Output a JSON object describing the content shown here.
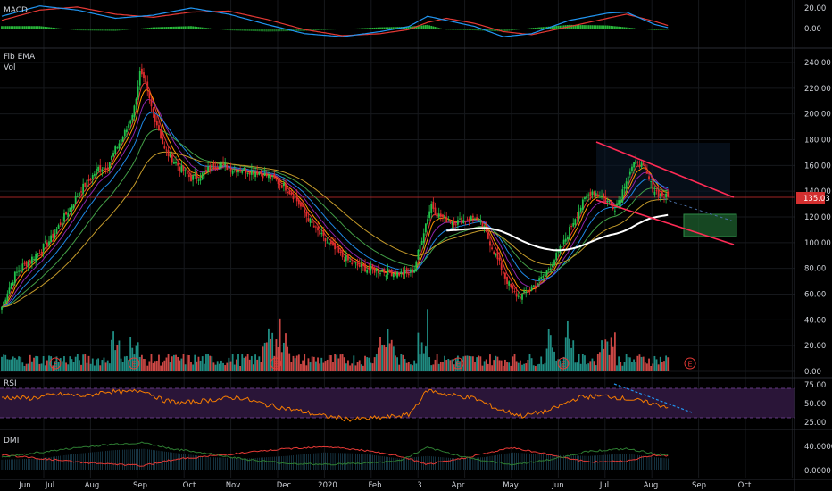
{
  "colors": {
    "background": "#000000",
    "grid": "#16181c",
    "separator": "#2a2d33",
    "text": "#cfd2d8",
    "up": "#26a69a",
    "down": "#ef5350",
    "upBright": "#22c34b",
    "downBright": "#e02d2d",
    "macdLine": "#2196f3",
    "signalLine": "#e53935",
    "histUp": "#2ecc40",
    "rsi": "#f57c00",
    "rsiBand": "#2a1538",
    "rsiBandEdge": "#7b4aa0",
    "pricePanelLine": "#d32f2f",
    "dmiPlus": "#2e7d32",
    "dmiMinus": "#e53935",
    "adx": "#4fc3f7",
    "channel": "#ff2b55",
    "target": "#1e5f2e",
    "ema": [
      "#e53935",
      "#ff9800",
      "#8e24aa",
      "#1e88e5",
      "#43a047",
      "#c49a2a"
    ],
    "longMA": "#ffffff",
    "earnings": "#e53935"
  },
  "panels": {
    "macd": {
      "label": "MACD",
      "ticks": [
        "20.00",
        "0.00"
      ]
    },
    "price": {
      "label1": "Fib EMA",
      "label2": "Vol",
      "ticks": [
        "240.00",
        "220.00",
        "200.00",
        "180.00",
        "160.00",
        "140.00",
        "120.00",
        "100.00",
        "80.00",
        "60.00",
        "40.00",
        "20.00",
        "0.00"
      ],
      "last_price": "135.03"
    },
    "rsi": {
      "label": "RSI",
      "ticks": [
        "75.00",
        "50.00",
        "25.00"
      ]
    },
    "dmi": {
      "label": "DMI",
      "ticks": [
        "40.0000",
        "0.0000"
      ]
    }
  },
  "earnings_label": "E",
  "chart_data": [
    {
      "type": "candlestick",
      "title": "Fib EMA",
      "x_labels": [
        "Jun",
        "Jul",
        "Aug",
        "Sep",
        "Oct",
        "Nov",
        "Dec",
        "2020",
        "Feb",
        "3",
        "Apr",
        "May",
        "Jun",
        "Jul",
        "Aug",
        "Sep",
        "Oct"
      ],
      "ylim": [
        0,
        250
      ],
      "last_price": 135.03,
      "close_path": [
        [
          0,
          50
        ],
        [
          3,
          62
        ],
        [
          7,
          75
        ],
        [
          11,
          82
        ],
        [
          16,
          88
        ],
        [
          21,
          95
        ],
        [
          26,
          103
        ],
        [
          31,
          115
        ],
        [
          36,
          127
        ],
        [
          41,
          140
        ],
        [
          46,
          148
        ],
        [
          51,
          158
        ],
        [
          56,
          160
        ],
        [
          61,
          175
        ],
        [
          66,
          188
        ],
        [
          70,
          205
        ],
        [
          73,
          232
        ],
        [
          76,
          222
        ],
        [
          79,
          205
        ],
        [
          83,
          188
        ],
        [
          86,
          172
        ],
        [
          90,
          165
        ],
        [
          95,
          157
        ],
        [
          100,
          150
        ],
        [
          105,
          152
        ],
        [
          110,
          158
        ],
        [
          115,
          162
        ],
        [
          120,
          158
        ],
        [
          125,
          157
        ],
        [
          130,
          156
        ],
        [
          135,
          155
        ],
        [
          140,
          152
        ],
        [
          145,
          148
        ],
        [
          150,
          143
        ],
        [
          155,
          135
        ],
        [
          160,
          123
        ],
        [
          165,
          112
        ],
        [
          170,
          103
        ],
        [
          175,
          96
        ],
        [
          180,
          89
        ],
        [
          185,
          84
        ],
        [
          190,
          81
        ],
        [
          195,
          79
        ],
        [
          200,
          78
        ],
        [
          205,
          77
        ],
        [
          210,
          76
        ],
        [
          215,
          76
        ],
        [
          218,
          80
        ],
        [
          221,
          98
        ],
        [
          224,
          115
        ],
        [
          227,
          130
        ],
        [
          230,
          122
        ],
        [
          235,
          118
        ],
        [
          240,
          116
        ],
        [
          245,
          118
        ],
        [
          250,
          120
        ],
        [
          252,
          116
        ],
        [
          255,
          110
        ],
        [
          258,
          100
        ],
        [
          261,
          90
        ],
        [
          264,
          80
        ],
        [
          267,
          70
        ],
        [
          270,
          62
        ],
        [
          273,
          58
        ],
        [
          276,
          60
        ],
        [
          279,
          64
        ],
        [
          282,
          68
        ],
        [
          285,
          72
        ],
        [
          288,
          78
        ],
        [
          291,
          85
        ],
        [
          294,
          92
        ],
        [
          297,
          100
        ],
        [
          300,
          110
        ],
        [
          303,
          120
        ],
        [
          306,
          128
        ],
        [
          309,
          136
        ],
        [
          312,
          140
        ],
        [
          315,
          138
        ],
        [
          318,
          135
        ],
        [
          321,
          130
        ],
        [
          324,
          128
        ],
        [
          327,
          136
        ],
        [
          330,
          150
        ],
        [
          333,
          158
        ],
        [
          336,
          164
        ],
        [
          338,
          160
        ],
        [
          341,
          152
        ],
        [
          344,
          142
        ],
        [
          347,
          138
        ],
        [
          350,
          136
        ],
        [
          352,
          135
        ]
      ]
    },
    {
      "type": "line",
      "title": "MACD",
      "ylim": [
        -10,
        30
      ],
      "series": [
        {
          "role": "macd",
          "points": [
            [
              0,
              12
            ],
            [
              20,
              22
            ],
            [
              40,
              18
            ],
            [
              60,
              10
            ],
            [
              80,
              13
            ],
            [
              100,
              20
            ],
            [
              120,
              14
            ],
            [
              140,
              4
            ],
            [
              160,
              -5
            ],
            [
              180,
              -8
            ],
            [
              200,
              -3
            ],
            [
              215,
              2
            ],
            [
              225,
              12
            ],
            [
              235,
              8
            ],
            [
              250,
              2
            ],
            [
              265,
              -8
            ],
            [
              280,
              -5
            ],
            [
              300,
              8
            ],
            [
              320,
              15
            ],
            [
              330,
              16
            ],
            [
              345,
              4
            ],
            [
              352,
              1
            ]
          ]
        },
        {
          "role": "signal",
          "points": [
            [
              0,
              8
            ],
            [
              20,
              18
            ],
            [
              40,
              21
            ],
            [
              60,
              14
            ],
            [
              80,
              11
            ],
            [
              100,
              16
            ],
            [
              120,
              17
            ],
            [
              140,
              9
            ],
            [
              160,
              -1
            ],
            [
              180,
              -7
            ],
            [
              200,
              -5
            ],
            [
              215,
              -1
            ],
            [
              225,
              6
            ],
            [
              235,
              10
            ],
            [
              250,
              5
            ],
            [
              265,
              -3
            ],
            [
              280,
              -6
            ],
            [
              300,
              2
            ],
            [
              320,
              10
            ],
            [
              330,
              14
            ],
            [
              345,
              7
            ],
            [
              352,
              3
            ]
          ]
        }
      ]
    },
    {
      "type": "line",
      "title": "RSI",
      "ylim": [
        10,
        90
      ],
      "series": [
        {
          "role": "rsi",
          "points": [
            [
              0,
              60
            ],
            [
              15,
              58
            ],
            [
              30,
              65
            ],
            [
              45,
              62
            ],
            [
              55,
              70
            ],
            [
              65,
              68
            ],
            [
              75,
              72
            ],
            [
              85,
              55
            ],
            [
              95,
              50
            ],
            [
              110,
              55
            ],
            [
              125,
              60
            ],
            [
              140,
              47
            ],
            [
              155,
              38
            ],
            [
              170,
              28
            ],
            [
              185,
              22
            ],
            [
              200,
              25
            ],
            [
              215,
              30
            ],
            [
              225,
              72
            ],
            [
              235,
              65
            ],
            [
              250,
              58
            ],
            [
              262,
              40
            ],
            [
              275,
              28
            ],
            [
              290,
              38
            ],
            [
              305,
              60
            ],
            [
              320,
              62
            ],
            [
              335,
              55
            ],
            [
              345,
              48
            ],
            [
              352,
              44
            ]
          ]
        }
      ]
    },
    {
      "type": "line",
      "title": "DMI",
      "ylim": [
        0,
        60
      ],
      "series": [
        {
          "role": "plus",
          "points": [
            [
              0,
              22
            ],
            [
              20,
              30
            ],
            [
              40,
              38
            ],
            [
              60,
              44
            ],
            [
              75,
              46
            ],
            [
              90,
              36
            ],
            [
              110,
              28
            ],
            [
              130,
              18
            ],
            [
              150,
              12
            ],
            [
              170,
              10
            ],
            [
              190,
              12
            ],
            [
              210,
              16
            ],
            [
              225,
              38
            ],
            [
              240,
              26
            ],
            [
              255,
              16
            ],
            [
              270,
              10
            ],
            [
              290,
              18
            ],
            [
              310,
              32
            ],
            [
              330,
              36
            ],
            [
              345,
              28
            ],
            [
              352,
              25
            ]
          ]
        },
        {
          "role": "minus",
          "points": [
            [
              0,
              26
            ],
            [
              20,
              20
            ],
            [
              40,
              14
            ],
            [
              60,
              10
            ],
            [
              75,
              8
            ],
            [
              90,
              18
            ],
            [
              110,
              24
            ],
            [
              130,
              30
            ],
            [
              150,
              36
            ],
            [
              170,
              40
            ],
            [
              190,
              34
            ],
            [
              210,
              24
            ],
            [
              225,
              10
            ],
            [
              240,
              18
            ],
            [
              255,
              28
            ],
            [
              270,
              38
            ],
            [
              290,
              26
            ],
            [
              310,
              14
            ],
            [
              330,
              16
            ],
            [
              345,
              26
            ],
            [
              352,
              24
            ]
          ]
        },
        {
          "role": "adx",
          "points": [
            [
              0,
              18
            ],
            [
              20,
              20
            ],
            [
              40,
              28
            ],
            [
              60,
              34
            ],
            [
              75,
              36
            ],
            [
              90,
              30
            ],
            [
              110,
              22
            ],
            [
              130,
              20
            ],
            [
              150,
              24
            ],
            [
              170,
              30
            ],
            [
              190,
              28
            ],
            [
              210,
              20
            ],
            [
              225,
              24
            ],
            [
              240,
              20
            ],
            [
              255,
              22
            ],
            [
              270,
              30
            ],
            [
              290,
              26
            ],
            [
              310,
              24
            ],
            [
              330,
              28
            ],
            [
              345,
              22
            ],
            [
              352,
              20
            ]
          ]
        }
      ]
    }
  ]
}
